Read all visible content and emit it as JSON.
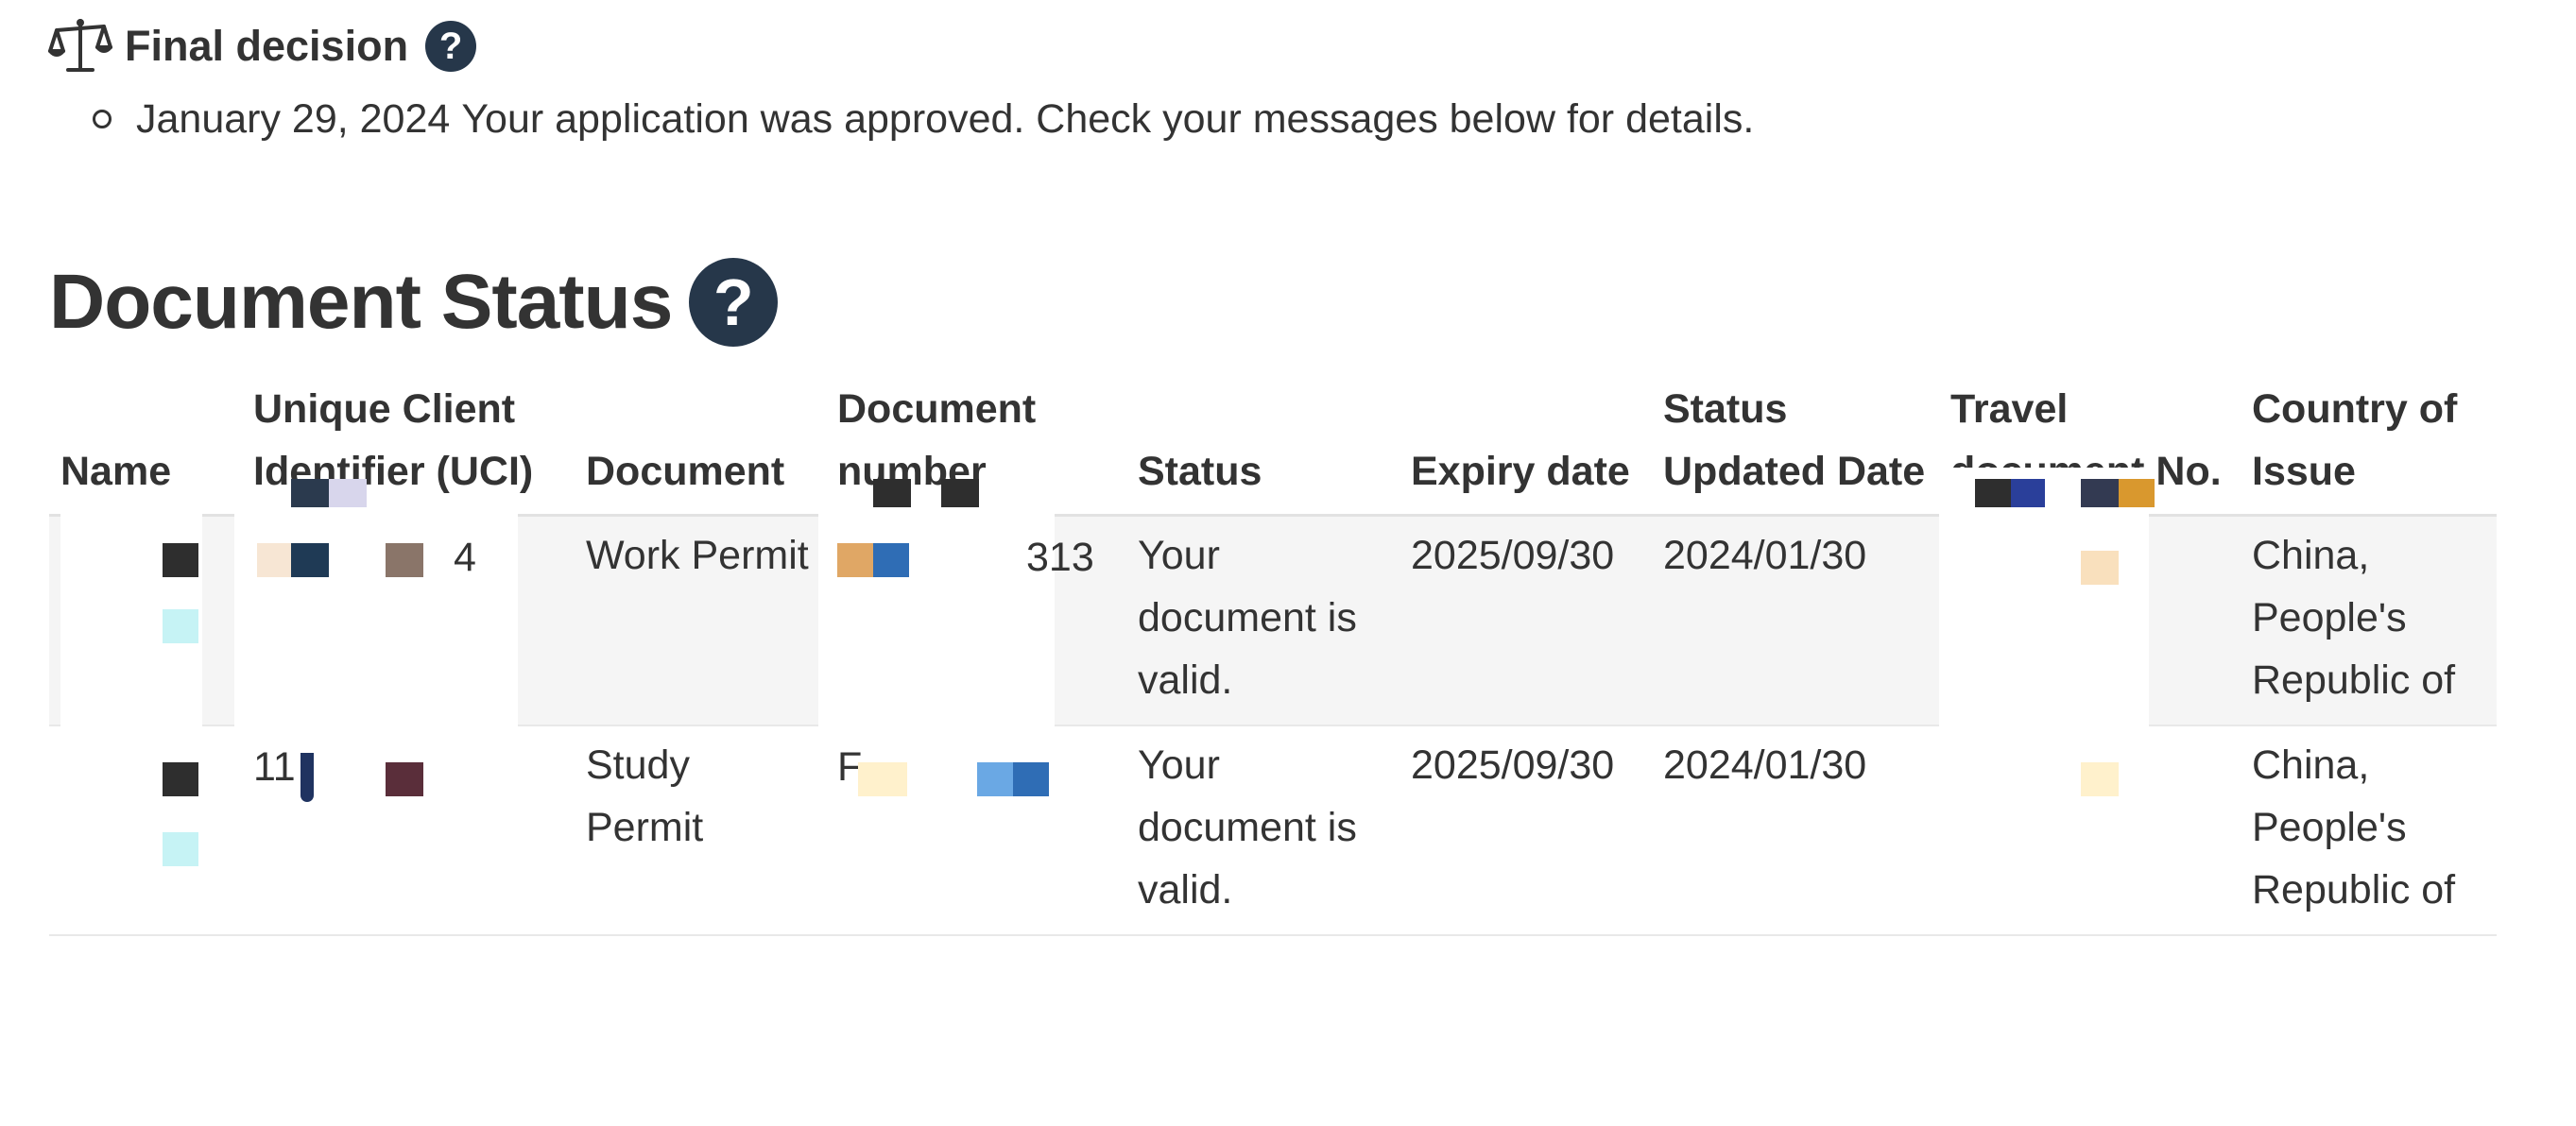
{
  "final_decision": {
    "icon": "scale-icon",
    "title": "Final decision",
    "help_label": "?",
    "items": [
      {
        "date": "January 29, 2024",
        "text": "Your application was approved. Check your messages below for details."
      }
    ]
  },
  "document_status": {
    "title": "Document Status",
    "help_label": "?",
    "columns": [
      "Name",
      "Unique Client Identifier (UCI)",
      "Document",
      "Document number",
      "Status",
      "Expiry date",
      "Status Updated Date",
      "Travel document No.",
      "Country of Issue"
    ],
    "rows": [
      {
        "document": "Work Permit",
        "document_number_suffix": "313",
        "status": "Your document is valid.",
        "expiry_date": "2025/09/30",
        "status_updated_date": "2024/01/30",
        "country_of_issue": "China, People's Republic of"
      },
      {
        "uci_prefix": "11",
        "document": "Study Permit",
        "document_number_prefix": "F",
        "status": "Your document is valid.",
        "expiry_date": "2025/09/30",
        "status_updated_date": "2024/01/30",
        "country_of_issue": "China, People's Republic of"
      }
    ]
  },
  "colors": {
    "text": "#333333",
    "help_icon_bg": "#26374a",
    "row_shade": "#f5f5f5"
  }
}
